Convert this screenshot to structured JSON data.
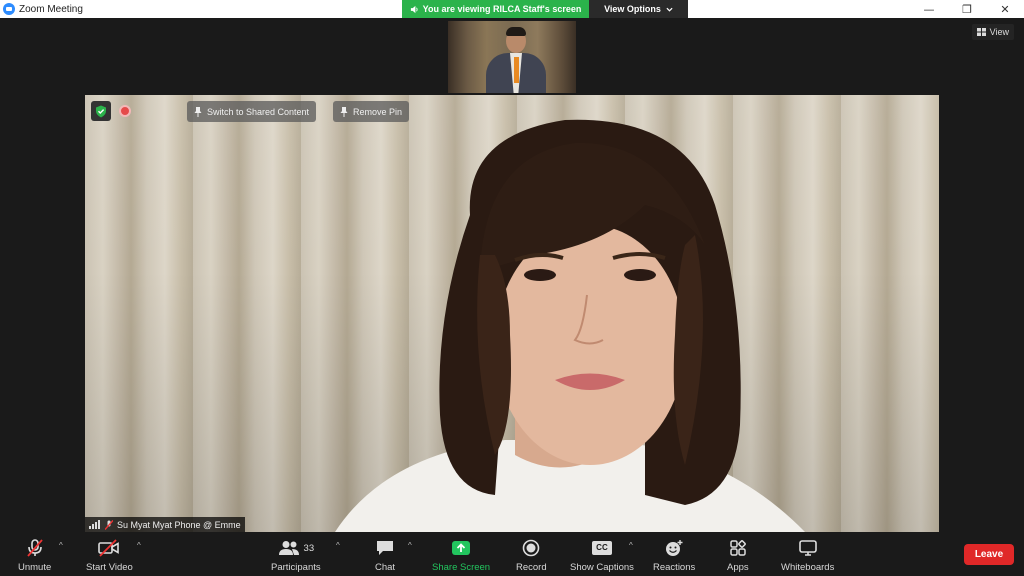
{
  "window": {
    "title": "Zoom Meeting",
    "controls": {
      "minimize": "—",
      "restore": "❐",
      "close": "✕"
    }
  },
  "share_banner": {
    "viewing_text": "You are viewing RILCA Staff's screen",
    "view_options_label": "View Options",
    "accent": "#2bb34b"
  },
  "view_button": {
    "label": "View"
  },
  "video": {
    "switch_label": "Switch to Shared Content",
    "remove_pin_label": "Remove Pin",
    "participant_name": "Su Myat Myat Phone @ Emme"
  },
  "toolbar": {
    "unmute": "Unmute",
    "start_video": "Start Video",
    "participants": "Participants",
    "participants_count": "33",
    "chat": "Chat",
    "share_screen": "Share Screen",
    "record": "Record",
    "show_captions": "Show Captions",
    "captions_icon_text": "CC",
    "reactions": "Reactions",
    "apps": "Apps",
    "whiteboards": "Whiteboards",
    "leave": "Leave",
    "share_accent": "#22c55e",
    "leave_color": "#e02828"
  }
}
